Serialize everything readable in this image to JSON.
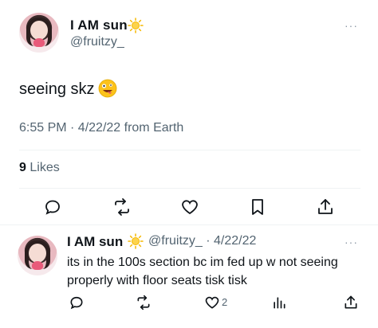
{
  "main_tweet": {
    "display_name": "I AM sun",
    "handle": "@fruitzy_",
    "text": "seeing skz",
    "timestamp": "6:55 PM · 4/22/22 from Earth",
    "likes_count": "9",
    "likes_label": "Likes",
    "more_glyph": "···"
  },
  "reply": {
    "display_name": "I AM sun",
    "handle_date": "@fruitzy_ · 4/22/22",
    "text": "its in the 100s section bc im fed up w not seeing properly with floor seats tisk tisk",
    "like_count": "2",
    "more_glyph": "···"
  },
  "icons": {
    "verified_badge": "sun-icon",
    "emoji": "zany-face-emoji",
    "actions": [
      "reply-icon",
      "retweet-icon",
      "heart-icon",
      "bookmark-icon",
      "share-icon"
    ],
    "reply_actions": [
      "reply-icon",
      "retweet-icon",
      "heart-icon",
      "views-icon",
      "share-icon"
    ]
  },
  "colors": {
    "text_primary": "#0f1419",
    "text_secondary": "#536471",
    "divider": "#eff3f4",
    "sun": "#f5b800"
  }
}
